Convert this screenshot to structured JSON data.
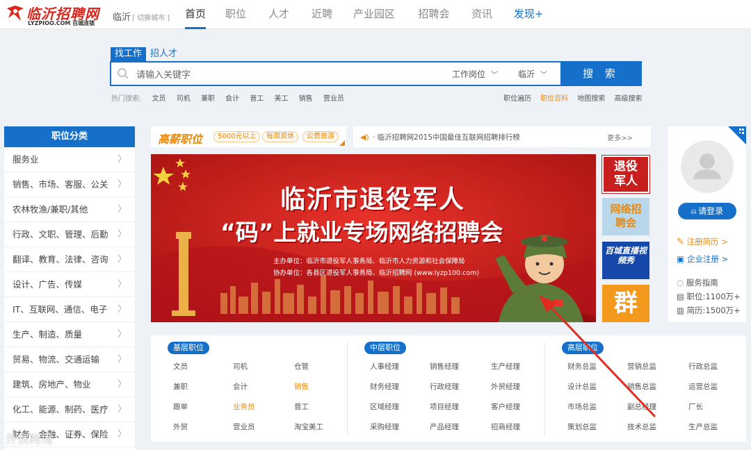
{
  "header": {
    "logo_text": "临沂招聘网",
    "logo_sub": "LYZPIOO.COM 百城连锁",
    "city": "临沂",
    "switch_city": "[ 切换城市 ]",
    "nav": [
      "首页",
      "职位",
      "人才",
      "近聘",
      "产业园区",
      "招聘会",
      "资讯",
      "发现+"
    ]
  },
  "search": {
    "tabs": [
      "找工作",
      "招人才"
    ],
    "placeholder": "请输入关键字",
    "dropdown_job": "工作岗位",
    "dropdown_city": "临沂",
    "button": "搜 索",
    "hot_label": "热门搜索:",
    "hot_words": [
      "文员",
      "司机",
      "兼职",
      "会计",
      "普工",
      "美工",
      "销售",
      "营业员"
    ],
    "links": [
      "职位遍历",
      "职位百科",
      "地图搜索",
      "高级搜索"
    ]
  },
  "category": {
    "title": "职位分类",
    "items": [
      "服务业",
      "销售、市场、客服、公关",
      "农林牧渔/兼职/其他",
      "行政、文职、管理、后勤",
      "翻译、教育、法律、咨询",
      "设计、广告、传媒",
      "IT、互联网、通信、电子",
      "生产、制造、质量",
      "贸易、物流、交通运输",
      "建筑、房地产、物业",
      "化工、能源、制药、医疗",
      "财务、金融、证券、保险"
    ]
  },
  "promo": {
    "title": "高薪职位",
    "tags": [
      "5000元以上",
      "每周双休",
      "公费旅游"
    ]
  },
  "news": {
    "text": "· 临沂招聘网2015中国最佳互联网招聘排行榜",
    "more": "更多>>"
  },
  "banner": {
    "title_line1": "临沂市退役军人",
    "title_line2": "“码”上就业专场网络招聘会",
    "host": "主办单位：临沂市退役军人事务局、临沂市人力资源和社会保障局",
    "co_host": "协办单位：各县区退役军人事务局、临沂招聘网 (www.lyzp100.com)"
  },
  "side_ads": [
    "退役军人",
    "网络招聘会",
    "百城直播视频秀",
    "群"
  ],
  "user": {
    "login": "请登录",
    "register_resume": "注册简历 >",
    "register_company": "企业注册 >",
    "guide": "服务指南",
    "jobs_count": "职位:1100万+",
    "resumes_count": "简历:1500万+"
  },
  "jobs": {
    "basic": {
      "title": "基层职位",
      "items": [
        "文员",
        "司机",
        "仓管",
        "兼职",
        "会计",
        "销售",
        "跟单",
        "业务员",
        "普工",
        "外贸",
        "营业员",
        "淘宝美工"
      ]
    },
    "middle": {
      "title": "中层职位",
      "items": [
        "人事经理",
        "销售经理",
        "生产经理",
        "财务经理",
        "行政经理",
        "外贸经理",
        "区域经理",
        "项目经理",
        "客户经理",
        "采购经理",
        "产品经理",
        "招商经理"
      ]
    },
    "senior": {
      "title": "高层职位",
      "items": [
        "财务总监",
        "营销总监",
        "行政总监",
        "设计总监",
        "销售总监",
        "运营总监",
        "市场总监",
        "副总经理",
        "厂长",
        "策划总监",
        "技术总监",
        "生产总监"
      ]
    }
  },
  "watermark": "外贸跨境",
  "colors": {
    "brand_blue": "#1670c9",
    "brand_red": "#d9271e",
    "accent_orange": "#e8890f"
  }
}
